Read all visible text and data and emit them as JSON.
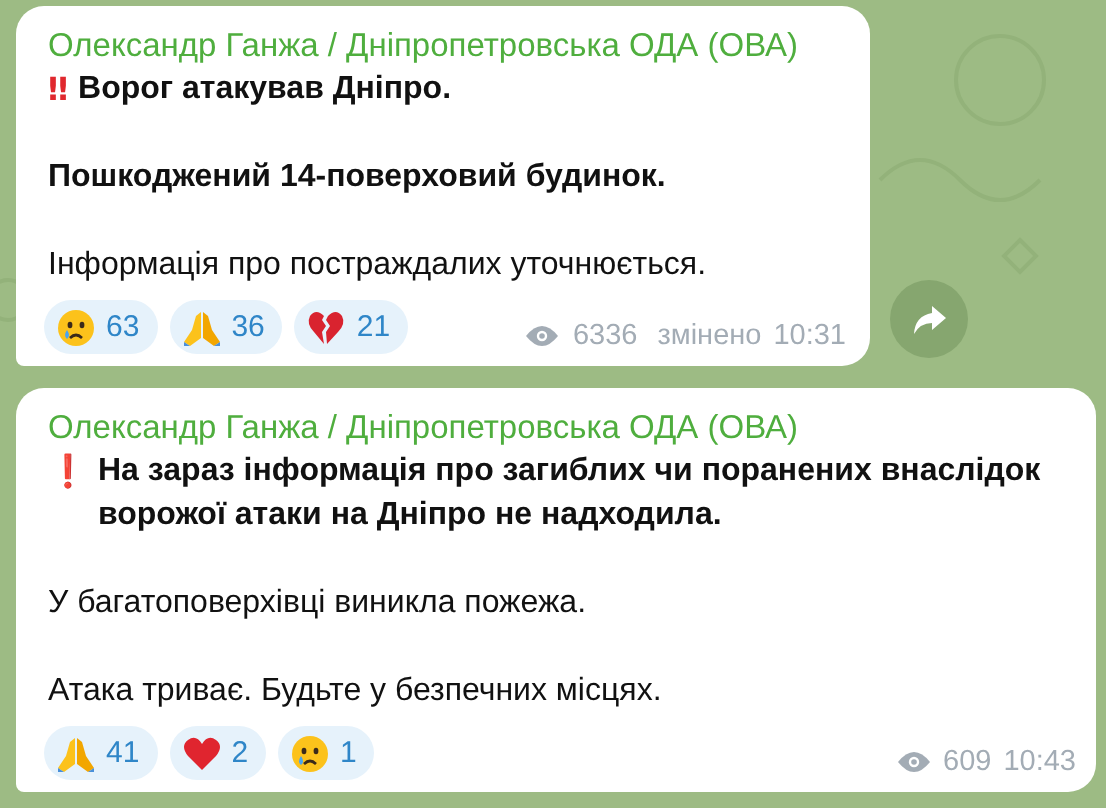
{
  "messages": [
    {
      "author": "Олександр Ганжа / Дніпропетровська ОДА (ОВА)",
      "paragraphs": [
        {
          "mark": "‼",
          "text": "Ворог атакував Дніпро.",
          "bold": true
        },
        {
          "text": "Пошкоджений 14-поверховий будинок.",
          "bold": true
        },
        {
          "text": "Інформація про постраждалих уточнюється.",
          "bold": false
        }
      ],
      "reactions": [
        {
          "kind": "crying",
          "count": "63"
        },
        {
          "kind": "praying",
          "count": "36"
        },
        {
          "kind": "broken-heart",
          "count": "21"
        }
      ],
      "views": "6336",
      "edited": "змінено",
      "time": "10:31",
      "share_button": true
    },
    {
      "author": "Олександр Ганжа / Дніпропетровська ОДА (ОВА)",
      "paragraphs": [
        {
          "mark": "❗",
          "text": "На зараз інформація про загиблих чи поранених внаслідок ворожої атаки на Дніпро не надходила.",
          "bold": true
        },
        {
          "text": "У багатоповерхівці виникла пожежа.",
          "bold": false
        },
        {
          "text": "Атака триває. Будьте у безпечних місцях.",
          "bold": false
        }
      ],
      "reactions": [
        {
          "kind": "praying",
          "count": "41"
        },
        {
          "kind": "heart",
          "count": "2"
        },
        {
          "kind": "crying",
          "count": "1"
        }
      ],
      "views": "609",
      "time": "10:43",
      "share_button": false
    }
  ]
}
